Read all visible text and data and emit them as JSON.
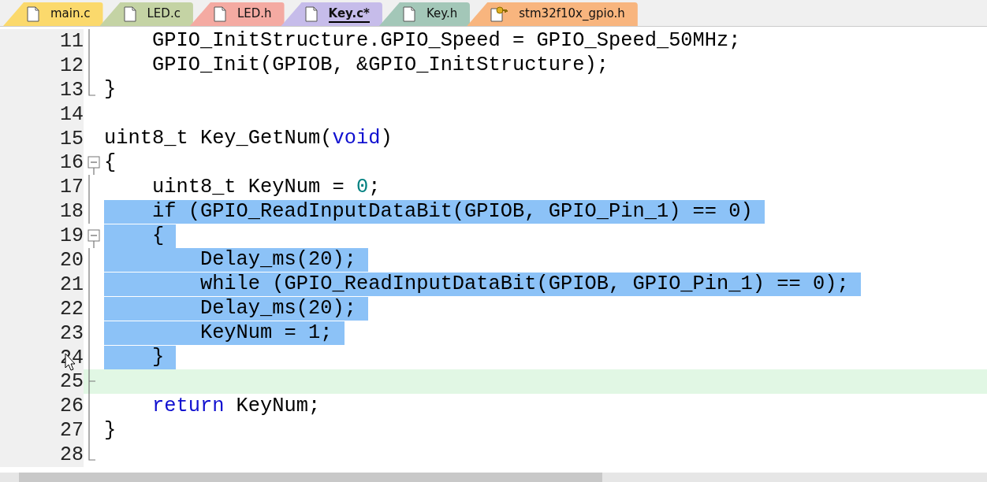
{
  "tabs": [
    {
      "label": "main.c",
      "color": "#fbd96c",
      "selected": false,
      "kind": "file"
    },
    {
      "label": "LED.c",
      "color": "#c4d3a4",
      "selected": false,
      "kind": "file"
    },
    {
      "label": "LED.h",
      "color": "#f4aaa2",
      "selected": false,
      "kind": "file"
    },
    {
      "label": "Key.c*",
      "color": "#c6bcea",
      "selected": true,
      "kind": "file"
    },
    {
      "label": "Key.h",
      "color": "#a3c7b8",
      "selected": false,
      "kind": "file"
    },
    {
      "label": "stm32f10x_gpio.h",
      "color": "#f8b57e",
      "selected": false,
      "kind": "key"
    }
  ],
  "lines": [
    {
      "number": "11",
      "kind": "fold_body",
      "selected": false,
      "current": false,
      "segments": [
        {
          "text": "    GPIO_InitStructure.GPIO_Speed = GPIO_Speed_50MHz;",
          "kind": "text"
        }
      ]
    },
    {
      "number": "12",
      "kind": "fold_body",
      "selected": false,
      "current": false,
      "segments": [
        {
          "text": "    GPIO_Init(GPIOB, &GPIO_InitStructure);",
          "kind": "text"
        }
      ]
    },
    {
      "number": "13",
      "kind": "fold_end",
      "selected": false,
      "current": false,
      "segments": [
        {
          "text": "}",
          "kind": "text"
        }
      ]
    },
    {
      "number": "14",
      "kind": "plain",
      "current": false
    },
    {
      "number": "15",
      "kind": "plain",
      "selected": false,
      "current": false,
      "segments": [
        {
          "text": "uint8_t Key_GetNum(",
          "kind": "text"
        },
        {
          "text": "void",
          "kind": "keyword"
        },
        {
          "text": ")",
          "kind": "text"
        }
      ]
    },
    {
      "number": "16",
      "kind": "fold_start",
      "selected": false,
      "current": false,
      "segments": [
        {
          "text": "{",
          "kind": "text"
        }
      ]
    },
    {
      "number": "17",
      "kind": "fold_body",
      "selected": false,
      "current": false,
      "segments": [
        {
          "text": "    uint8_t KeyNum = ",
          "kind": "text"
        },
        {
          "text": "0",
          "kind": "number"
        },
        {
          "text": ";",
          "kind": "text"
        }
      ]
    },
    {
      "number": "18",
      "kind": "fold_body",
      "selected": true,
      "current": false,
      "segments": [
        {
          "text": "    if (GPIO_ReadInputDataBit(GPIOB, GPIO_Pin_1) == 0)",
          "kind": "text"
        }
      ]
    },
    {
      "number": "19",
      "kind": "fold_start",
      "selected": true,
      "current": false,
      "segments": [
        {
          "text": "    {",
          "kind": "text"
        }
      ]
    },
    {
      "number": "20",
      "kind": "fold_body",
      "selected": true,
      "current": false,
      "segments": [
        {
          "text": "        Delay_ms(20);",
          "kind": "text"
        }
      ]
    },
    {
      "number": "21",
      "kind": "fold_body",
      "selected": true,
      "current": false,
      "segments": [
        {
          "text": "        while (GPIO_ReadInputDataBit(GPIOB, GPIO_Pin_1) == 0);",
          "kind": "text"
        }
      ]
    },
    {
      "number": "22",
      "kind": "fold_body",
      "selected": true,
      "current": false,
      "segments": [
        {
          "text": "        Delay_ms(20);",
          "kind": "text"
        }
      ]
    },
    {
      "number": "23",
      "kind": "fold_body",
      "selected": true,
      "current": false,
      "segments": [
        {
          "text": "        KeyNum = 1;",
          "kind": "text"
        }
      ]
    },
    {
      "number": "24",
      "kind": "fold_body",
      "selected": true,
      "current": false,
      "segments": [
        {
          "text": "    }",
          "kind": "text"
        }
      ]
    },
    {
      "number": "25",
      "kind": "fold_inner_end",
      "current": true
    },
    {
      "number": "26",
      "kind": "fold_body",
      "selected": false,
      "current": false,
      "segments": [
        {
          "text": "    return",
          "kind": "keyword"
        },
        {
          "text": " KeyNum;",
          "kind": "text"
        }
      ]
    },
    {
      "number": "27",
      "kind": "fold_body",
      "selected": false,
      "current": false,
      "segments": [
        {
          "text": "}",
          "kind": "text"
        }
      ]
    },
    {
      "number": "28",
      "kind": "fold_end",
      "current": false
    }
  ]
}
